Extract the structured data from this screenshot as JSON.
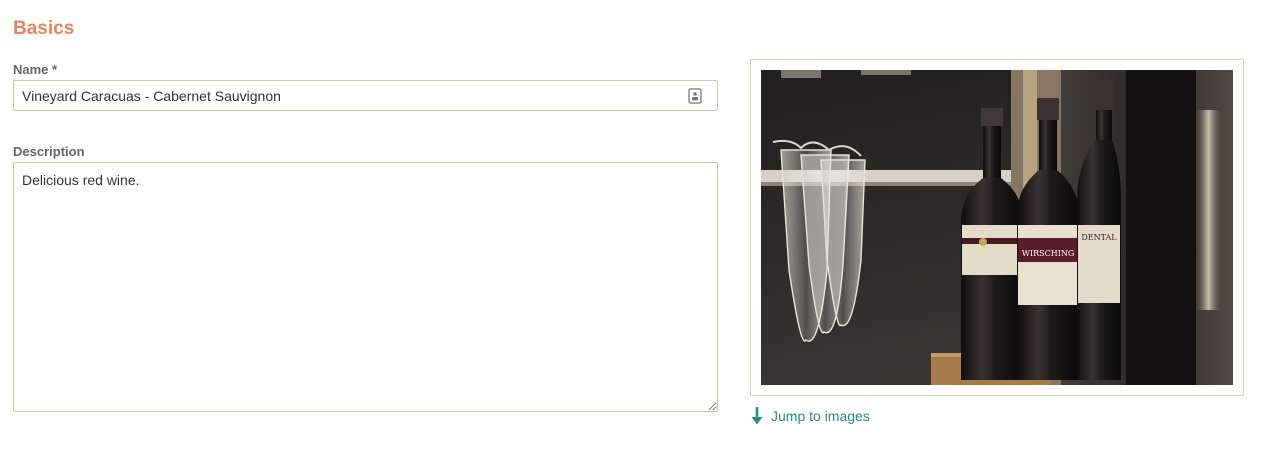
{
  "section": {
    "title": "Basics"
  },
  "name_field": {
    "label": "Name *",
    "value": "Vineyard Caracuas - Cabernet Sauvignon",
    "icon": "contact-card-icon"
  },
  "description_field": {
    "label": "Description",
    "value": "Delicious red wine."
  },
  "image_preview": {
    "alt": "Wine bottles and hanging glasses",
    "label_texts": [
      "WIRSCHING",
      "DENTAL"
    ]
  },
  "jump_link": {
    "label": "Jump to images",
    "icon": "arrow-down-icon"
  },
  "colors": {
    "accent": "#e8835a",
    "link": "#2a8a82",
    "border": "#c9c9a8"
  }
}
